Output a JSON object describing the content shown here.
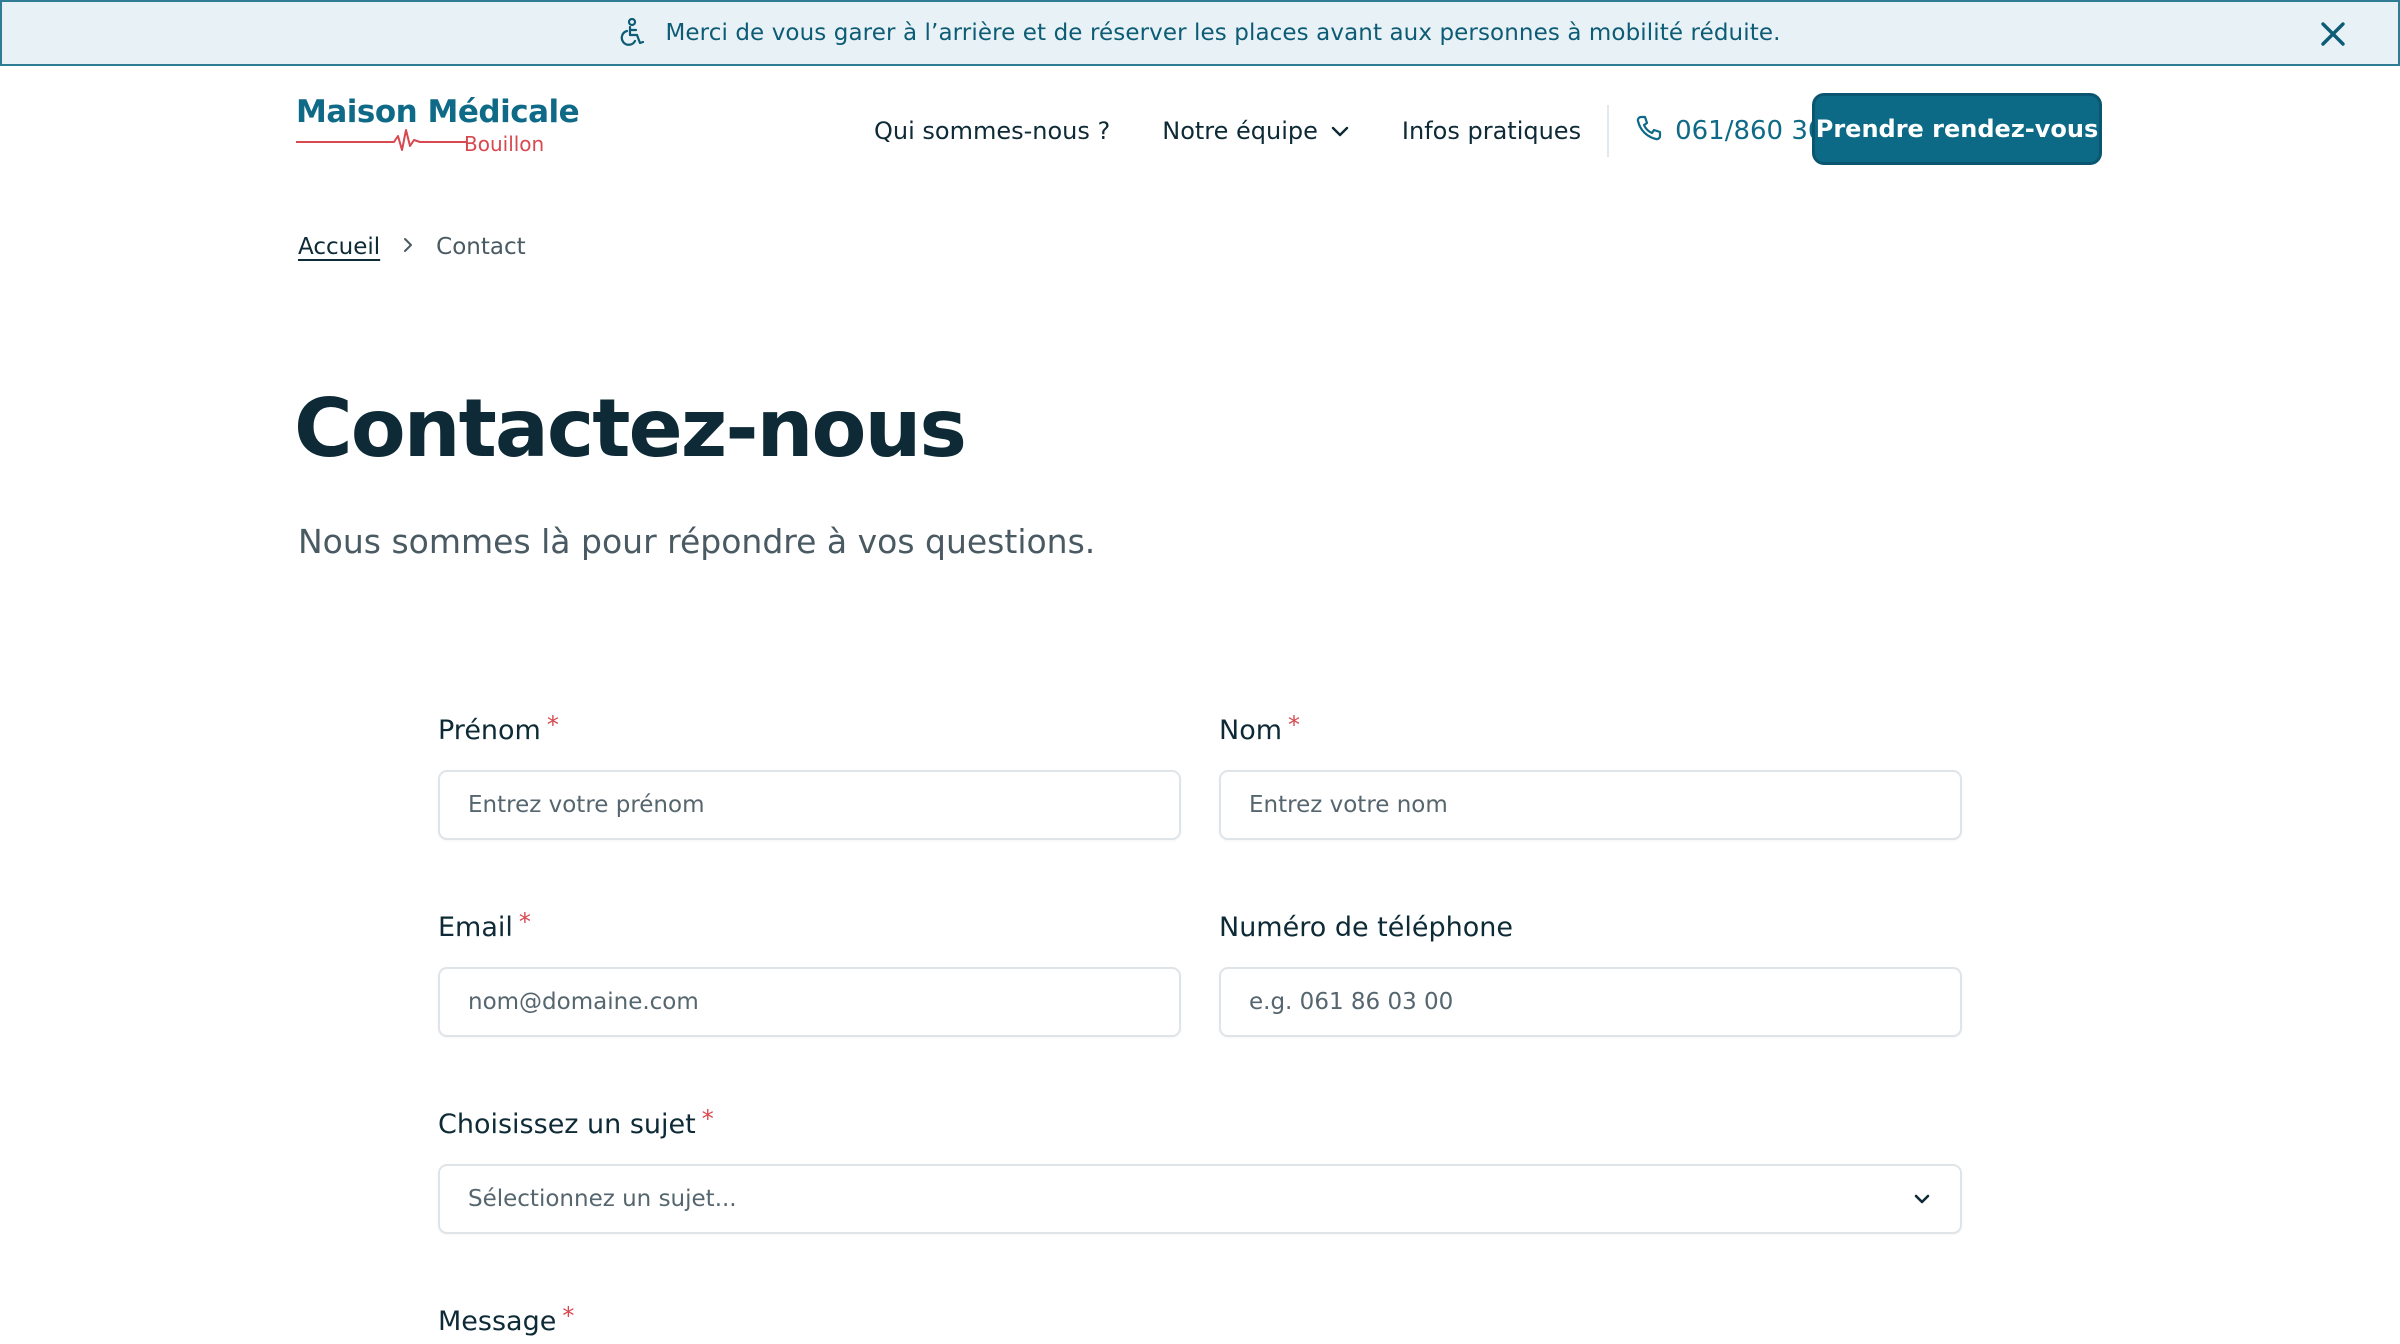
{
  "banner": {
    "icon": "wheelchair-icon",
    "text": "Merci de vous garer à l’arrière et de réserver les places avant aux personnes à mobilité réduite.",
    "close_icon": "close-icon"
  },
  "header": {
    "logo": {
      "title": "Maison Médicale",
      "subtitle": "Bouillon"
    },
    "nav": {
      "about": "Qui sommes-nous ?",
      "team": "Notre équipe",
      "info": "Infos pratiques",
      "phone": "061/860 300"
    },
    "cta": "Prendre rendez-vous"
  },
  "breadcrumb": {
    "home": "Accueil",
    "current": "Contact"
  },
  "page": {
    "title": "Contactez-nous",
    "subtitle": "Nous sommes là pour répondre à vos questions."
  },
  "form": {
    "firstname": {
      "label": "Prénom",
      "required": "*",
      "placeholder": "Entrez votre prénom"
    },
    "lastname": {
      "label": "Nom",
      "required": "*",
      "placeholder": "Entrez votre nom"
    },
    "email": {
      "label": "Email",
      "required": "*",
      "placeholder": "nom@domaine.com"
    },
    "phone": {
      "label": "Numéro de téléphone",
      "placeholder": "e.g. 061 86 03 00"
    },
    "subject": {
      "label": "Choisissez un sujet",
      "required": "*",
      "selected": "Sélectionnez un sujet..."
    },
    "message": {
      "label": "Message",
      "required": "*"
    }
  },
  "colors": {
    "brand": "#0d6a86",
    "accent_red": "#d8484f",
    "banner_bg": "#e8f1f5",
    "text_dark": "#0d2a36"
  }
}
